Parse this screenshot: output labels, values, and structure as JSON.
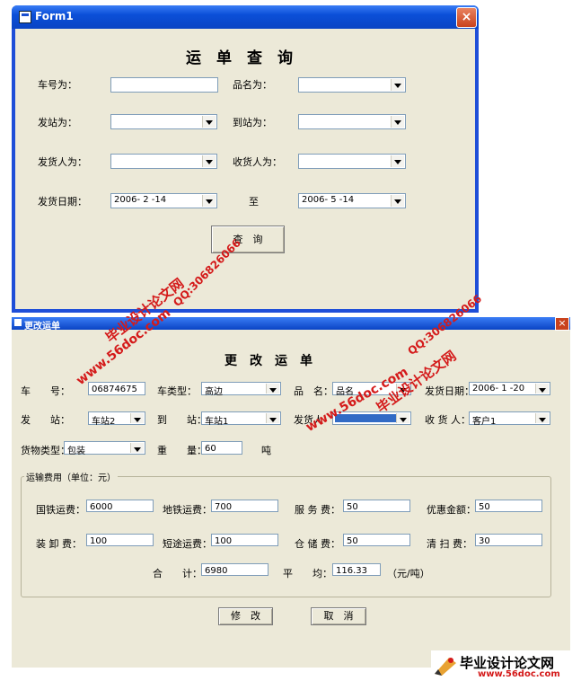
{
  "window1": {
    "title": "Form1",
    "close": "×",
    "heading": "运　单　查　询",
    "car_no_label": "车号为：",
    "car_no_value": "",
    "product_label": "品名为：",
    "product_value": "",
    "from_label": "发站为：",
    "from_value": "",
    "to_label": "到站为：",
    "to_value": "",
    "shipper_label": "发货人为：",
    "shipper_value": "",
    "receiver_label": "收货人为：",
    "receiver_value": "",
    "date_label": "发货日期：",
    "date_from": "2006- 2 -14",
    "to_text": "至",
    "date_to": "2006- 5 -14",
    "query_button": "查　询"
  },
  "window2": {
    "title": "更改运单",
    "close": "×",
    "heading": "更　改　运　单",
    "car_no_label": "车　　号：",
    "car_no_value": "06874675",
    "car_type_label": "车类型：",
    "car_type_value": "高边",
    "product_label": "品　名：",
    "product_value": "品名",
    "ship_date_label": "发货日期：",
    "ship_date_value": "2006- 1 -20",
    "from_label": "发　　站：",
    "from_value": "车站2",
    "to_label": "到　　站：",
    "to_value": "车站1",
    "shipper_label": "发货人",
    "shipper_value": "",
    "receiver_label": "收 货 人：",
    "receiver_value": "客户1",
    "cargo_type_label": "货物类型：",
    "cargo_type_value": "包装",
    "weight_label": "重　　量：",
    "weight_value": "60",
    "weight_unit": "吨",
    "fees_group_title": "运输费用（单位：元）",
    "rail_fee_label": "国铁运费：",
    "rail_fee_value": "6000",
    "local_rail_fee_label": "地铁运费：",
    "local_rail_fee_value": "700",
    "service_fee_label": "服 务 费：",
    "service_fee_value": "50",
    "discount_label": "优惠金额：",
    "discount_value": "50",
    "loading_fee_label": "装 卸 费：",
    "loading_fee_value": "100",
    "short_haul_fee_label": "短途运费：",
    "short_haul_fee_value": "100",
    "storage_fee_label": "仓 储 费：",
    "storage_fee_value": "50",
    "cleaning_fee_label": "清 扫 费：",
    "cleaning_fee_value": "30",
    "total_label": "合　　计：",
    "total_value": "6980",
    "average_label": "平　　均：",
    "average_value": "116.33",
    "average_unit": "（元/吨）",
    "modify_button": "修　改",
    "cancel_button": "取　消"
  },
  "watermarks": {
    "site": "www.56doc.com",
    "name": "毕业设计论文网",
    "qq": "QQ:306826066"
  },
  "logo": {
    "text": "毕业设计论文网",
    "url": "www.56doc.com"
  },
  "colors": {
    "window_bg": "#ece9d8",
    "titlebar_blue": "#0a44c4",
    "watermark_red": "#d41a1a"
  }
}
